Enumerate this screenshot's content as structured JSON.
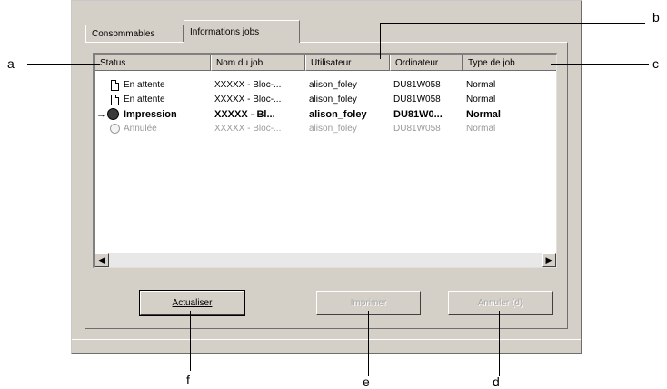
{
  "tabs": [
    {
      "label": "Consommables"
    },
    {
      "label": "Informations jobs"
    }
  ],
  "columns": [
    "Status",
    "Nom du job",
    "Utilisateur",
    "Ordinateur",
    "Type de job"
  ],
  "rows": [
    {
      "status": "En attente",
      "job": "XXXXX - Bloc-...",
      "user": "alison_foley",
      "computer": "DU81W058",
      "type": "Normal",
      "icon": "document-icon",
      "state": "waiting"
    },
    {
      "status": "En attente",
      "job": "XXXXX - Bloc-...",
      "user": "alison_foley",
      "computer": "DU81W058",
      "type": "Normal",
      "icon": "document-icon",
      "state": "waiting"
    },
    {
      "status": "Impression",
      "job": "XXXXX - Bl...",
      "user": "alison_foley",
      "computer": "DU81W0...",
      "type": "Normal",
      "icon": "printing-icon",
      "state": "printing"
    },
    {
      "status": "Annulée",
      "job": "XXXXX - Bloc-...",
      "user": "alison_foley",
      "computer": "DU81W058",
      "type": "Normal",
      "icon": "cancelled-icon",
      "state": "cancelled"
    }
  ],
  "buttons": {
    "refresh": "Actualiser",
    "print": "Imprimer",
    "cancel": "Annuler (d)"
  },
  "callouts": [
    "a",
    "b",
    "c",
    "d",
    "e",
    "f"
  ]
}
